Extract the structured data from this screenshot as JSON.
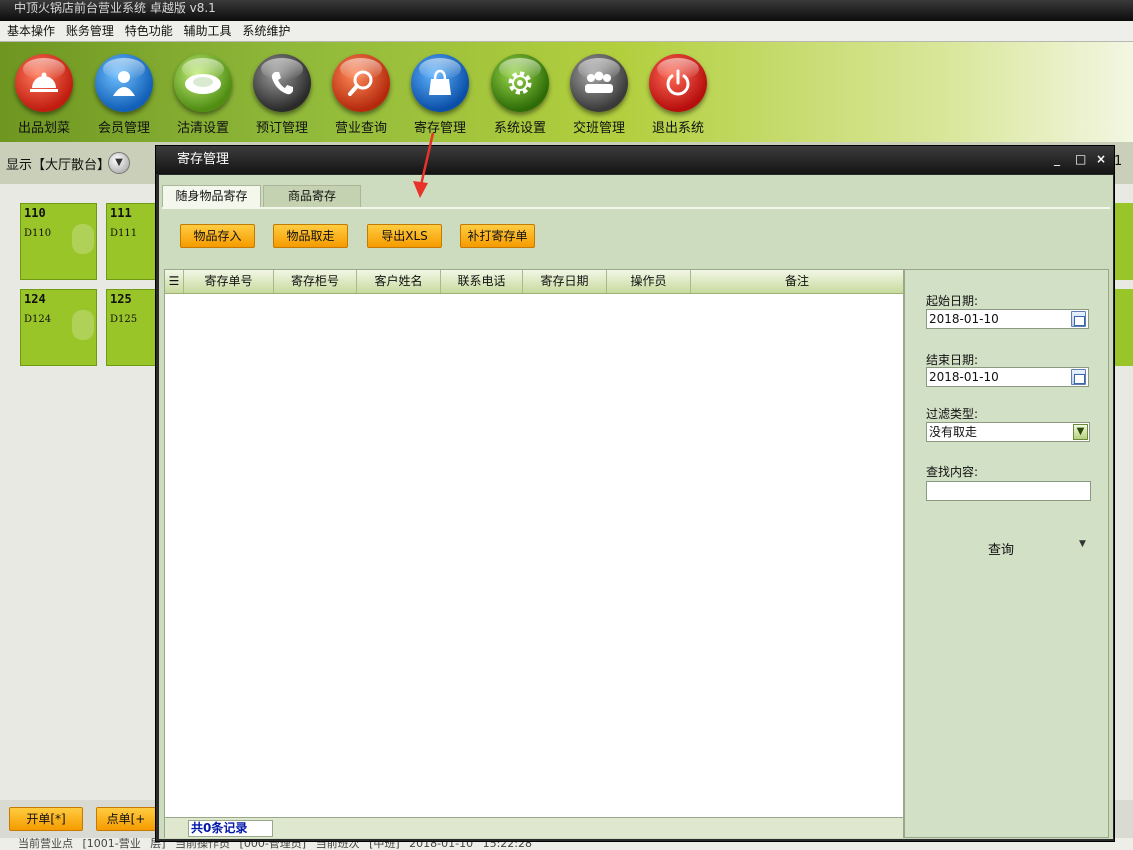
{
  "app": {
    "title": "中顶火锅店前台营业系统 卓越版 v8.1"
  },
  "menu": [
    "基本操作",
    "账务管理",
    "特色功能",
    "辅助工具",
    "系统维护"
  ],
  "toolbar": [
    {
      "label": "出品划菜",
      "icon": "cloche-icon"
    },
    {
      "label": "会员管理",
      "icon": "member-icon"
    },
    {
      "label": "沽清设置",
      "icon": "plate-icon"
    },
    {
      "label": "预订管理",
      "icon": "phone-icon"
    },
    {
      "label": "营业查询",
      "icon": "magnifier-icon"
    },
    {
      "label": "寄存管理",
      "icon": "bag-icon"
    },
    {
      "label": "系统设置",
      "icon": "gear-icon"
    },
    {
      "label": "交班管理",
      "icon": "people-icon"
    },
    {
      "label": "退出系统",
      "icon": "power-icon"
    }
  ],
  "display": {
    "label": "显示【大厅散台】",
    "right_text": "1"
  },
  "tables": [
    {
      "num": "110",
      "code": "D110"
    },
    {
      "num": "111",
      "code": "D111"
    },
    {
      "num": "124",
      "code": "D124"
    },
    {
      "num": "125",
      "code": "D125"
    }
  ],
  "bottom_buttons": [
    "开单[*]",
    "点单[+"
  ],
  "statusbar": "当前营业点 [1001-营业 层]   当前操作员 [000-管理员]   当前班次 [中班]   2018-01-10 15:22:28",
  "dialog": {
    "title": "寄存管理",
    "controls": [
      "_",
      "□",
      "×"
    ],
    "tabs": [
      "随身物品寄存",
      "商品寄存"
    ],
    "buttons": [
      "物品存入",
      "物品取走",
      "导出XLS",
      "补打寄存单"
    ],
    "columns": [
      "寄存单号",
      "寄存柜号",
      "客户姓名",
      "联系电话",
      "寄存日期",
      "操作员",
      "备注"
    ],
    "record_count": "共0条记录",
    "filters": {
      "start_label": "起始日期:",
      "start_value": "2018-01-10",
      "end_label": "结束日期:",
      "end_value": "2018-01-10",
      "type_label": "过滤类型:",
      "type_value": "没有取走",
      "search_label": "查找内容:",
      "search_value": ""
    },
    "query_label": "查询"
  },
  "accent": "#f59b00",
  "annotation_arrow_color": "#e8322a"
}
